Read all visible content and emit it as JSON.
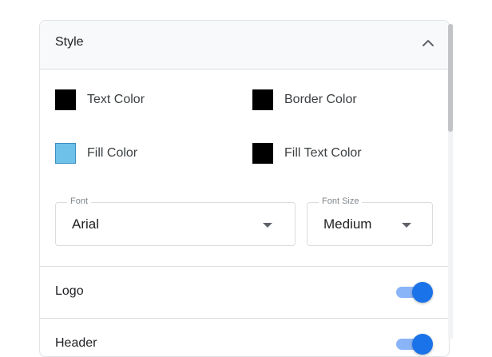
{
  "style_section": {
    "title": "Style",
    "colors": [
      {
        "label": "Text Color",
        "swatch": "#000000"
      },
      {
        "label": "Border Color",
        "swatch": "#000000"
      },
      {
        "label": "Fill Color",
        "swatch": "#6ec1e9"
      },
      {
        "label": "Fill Text Color",
        "swatch": "#000000"
      }
    ],
    "font": {
      "legend": "Font",
      "value": "Arial"
    },
    "font_size": {
      "legend": "Font Size",
      "value": "Medium"
    }
  },
  "toggles": [
    {
      "label": "Logo",
      "on": true
    },
    {
      "label": "Header",
      "on": true
    }
  ],
  "theme": {
    "accent": "#1a73e8",
    "accent_track": "#8ab4f8",
    "fill_swatch_border": "#3c8fc2"
  }
}
